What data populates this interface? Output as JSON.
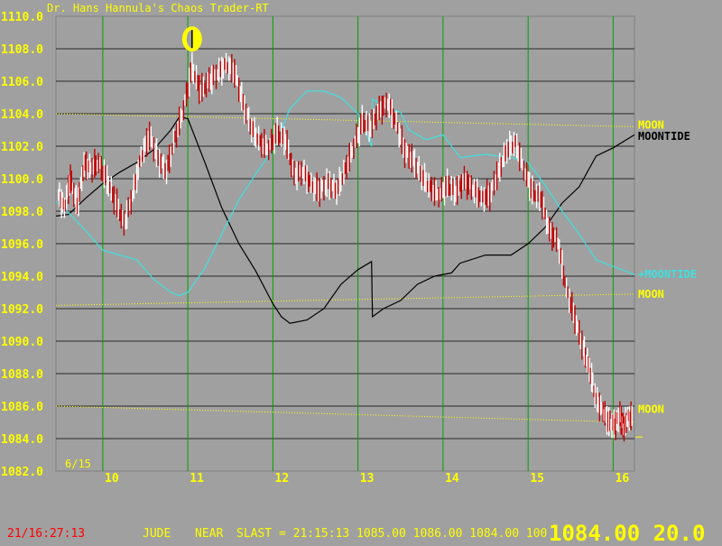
{
  "app_title": "Dr. Hans Hannula's Chaos Trader-RT",
  "colors": {
    "background": "#a0a0a0",
    "price_up": "#ffffff",
    "price_down": "#c00000",
    "moontide": "#000000",
    "plus_moontide": "#40e0e0",
    "moon": "#ffff00",
    "grid_vertical": "#00a000",
    "grid_horizontal": "#000000",
    "axis_text": "#ffff00",
    "clock": "#ff0000"
  },
  "chart_data": {
    "type": "line",
    "title": "Dr. Hans Hannula's Chaos Trader-RT",
    "date_label": "6/15",
    "xlabel": "",
    "ylabel": "",
    "xlim": [
      9.45,
      16.25
    ],
    "ylim": [
      1082.0,
      1110.0
    ],
    "x_ticks": [
      10,
      11,
      12,
      13,
      14,
      15,
      16
    ],
    "x_tick_labels": [
      "10",
      "11",
      "12",
      "13",
      "14",
      "15",
      "16"
    ],
    "y_ticks": [
      1082.0,
      1084.0,
      1086.0,
      1088.0,
      1090.0,
      1092.0,
      1094.0,
      1096.0,
      1098.0,
      1100.0,
      1102.0,
      1104.0,
      1106.0,
      1108.0,
      1110.0
    ],
    "y_tick_labels": [
      "1082.0",
      "1084.0",
      "1086.0",
      "1088.0",
      "1090.0",
      "1092.0",
      "1094.0",
      "1096.0",
      "1098.0",
      "1100.0",
      "1102.0",
      "1104.0",
      "1106.0",
      "1108.0",
      "1110.0"
    ],
    "grid": true,
    "moon_phase_marker": {
      "x": 11.05,
      "y": 1108.6,
      "icon": "half-moon-icon"
    },
    "series": [
      {
        "name": "MOONTIDE",
        "kind": "line",
        "x": [
          9.45,
          9.6,
          9.8,
          10.0,
          10.2,
          10.4,
          10.6,
          10.8,
          10.9,
          11.0,
          11.2,
          11.4,
          11.6,
          11.8,
          12.0,
          12.1,
          12.2,
          12.4,
          12.6,
          12.8,
          13.0,
          13.16,
          13.17,
          13.3,
          13.5,
          13.7,
          13.9,
          14.1,
          14.2,
          14.5,
          14.8,
          15.0,
          15.2,
          15.4,
          15.6,
          15.8,
          16.0,
          16.25
        ],
        "y": [
          1097.7,
          1097.8,
          1098.8,
          1099.7,
          1100.4,
          1101.0,
          1101.8,
          1103.0,
          1103.8,
          1103.7,
          1101.0,
          1098.2,
          1096.0,
          1094.3,
          1092.3,
          1091.5,
          1091.1,
          1091.3,
          1092.0,
          1093.5,
          1094.4,
          1094.9,
          1091.5,
          1092.0,
          1092.5,
          1093.5,
          1094.0,
          1094.2,
          1094.8,
          1095.3,
          1095.3,
          1096.0,
          1097.0,
          1098.5,
          1099.5,
          1101.4,
          1101.9,
          1102.7
        ]
      },
      {
        "name": "+MOONTIDE",
        "kind": "line",
        "x": [
          9.45,
          9.6,
          9.8,
          10.0,
          10.2,
          10.4,
          10.6,
          10.8,
          10.9,
          11.0,
          11.2,
          11.4,
          11.6,
          11.8,
          12.0,
          12.1,
          12.2,
          12.4,
          12.6,
          12.8,
          13.0,
          13.16,
          13.17,
          13.3,
          13.5,
          13.6,
          13.8,
          14.0,
          14.2,
          14.5,
          14.8,
          15.0,
          15.2,
          15.4,
          15.6,
          15.8,
          16.0,
          16.25
        ],
        "y": [
          1098.6,
          1097.9,
          1096.8,
          1095.6,
          1095.3,
          1095.0,
          1093.8,
          1093.0,
          1092.8,
          1093.0,
          1094.5,
          1096.6,
          1098.7,
          1100.3,
          1101.8,
          1103.0,
          1104.3,
          1105.4,
          1105.4,
          1105.0,
          1104.0,
          1102.0,
          1104.9,
          1104.5,
          1104.1,
          1103.0,
          1102.4,
          1102.7,
          1101.3,
          1101.5,
          1101.3,
          1101.0,
          1099.6,
          1098.0,
          1096.6,
          1095.0,
          1094.6,
          1094.1
        ]
      },
      {
        "name": "MOON",
        "kind": "dotted",
        "x": [
          9.45,
          16.25
        ],
        "y": [
          1104.0,
          1103.2
        ]
      },
      {
        "name": "MOON",
        "kind": "dotted",
        "x": [
          9.45,
          16.25
        ],
        "y": [
          1092.2,
          1092.9
        ]
      },
      {
        "name": "MOON",
        "kind": "dotted",
        "x": [
          9.45,
          16.25
        ],
        "y": [
          1086.0,
          1085.0
        ]
      }
    ],
    "right_labels": [
      {
        "text": "MOON",
        "y": 1103.3,
        "color": "#ffff00"
      },
      {
        "text": "MOONTIDE",
        "y": 1102.6,
        "color": "#000000"
      },
      {
        "text": "+MOONTIDE",
        "y": 1094.1,
        "color": "#40e0e0"
      },
      {
        "text": "MOON",
        "y": 1092.9,
        "color": "#ffff00"
      },
      {
        "text": "MOON",
        "y": 1085.8,
        "color": "#ffff00"
      }
    ],
    "last_price_marker": 1084.1,
    "price_bars": {
      "x": [
        9.48,
        9.55,
        9.62,
        9.7,
        9.78,
        9.86,
        9.95,
        10.05,
        10.15,
        10.25,
        10.35,
        10.45,
        10.55,
        10.65,
        10.75,
        10.85,
        10.95,
        11.05,
        11.15,
        11.25,
        11.35,
        11.45,
        11.55,
        11.65,
        11.75,
        11.85,
        11.95,
        12.05,
        12.15,
        12.25,
        12.35,
        12.45,
        12.55,
        12.65,
        12.75,
        12.85,
        12.95,
        13.05,
        13.15,
        13.25,
        13.35,
        13.45,
        13.55,
        13.65,
        13.75,
        13.85,
        13.95,
        14.05,
        14.15,
        14.25,
        14.35,
        14.45,
        14.55,
        14.65,
        14.75,
        14.85,
        14.95,
        15.05,
        15.15,
        15.25,
        15.35,
        15.45,
        15.55,
        15.65,
        15.72,
        15.8,
        15.88,
        15.95,
        16.02,
        16.08,
        16.12,
        16.17
      ],
      "close": [
        1099.0,
        1098.2,
        1100.0,
        1098.3,
        1100.9,
        1100.6,
        1101.0,
        1099.9,
        1098.6,
        1097.2,
        1099.0,
        1101.3,
        1102.7,
        1101.2,
        1100.5,
        1102.5,
        1104.3,
        1106.8,
        1105.4,
        1106.0,
        1106.5,
        1107.0,
        1106.6,
        1104.6,
        1103.1,
        1102.2,
        1101.9,
        1102.8,
        1102.4,
        1100.2,
        1100.5,
        1099.6,
        1099.3,
        1099.7,
        1099.3,
        1100.5,
        1102.0,
        1103.5,
        1103.2,
        1104.2,
        1104.7,
        1103.4,
        1101.7,
        1101.1,
        1100.2,
        1099.4,
        1099.0,
        1099.6,
        1099.2,
        1099.9,
        1099.4,
        1098.8,
        1099.0,
        1100.4,
        1101.8,
        1102.2,
        1100.6,
        1099.2,
        1098.8,
        1096.8,
        1096.1,
        1093.2,
        1091.4,
        1089.5,
        1088.3,
        1086.4,
        1085.7,
        1085.0,
        1084.8,
        1085.5,
        1084.6,
        1085.3
      ]
    }
  },
  "status": {
    "clock": "21/16:27:13",
    "symbol": "JUDE",
    "near": "NEAR",
    "last_line": "SLAST = 21:15:13 1085.00 1086.00 1084.00 100",
    "big_readout": "1084.00 20.0"
  }
}
